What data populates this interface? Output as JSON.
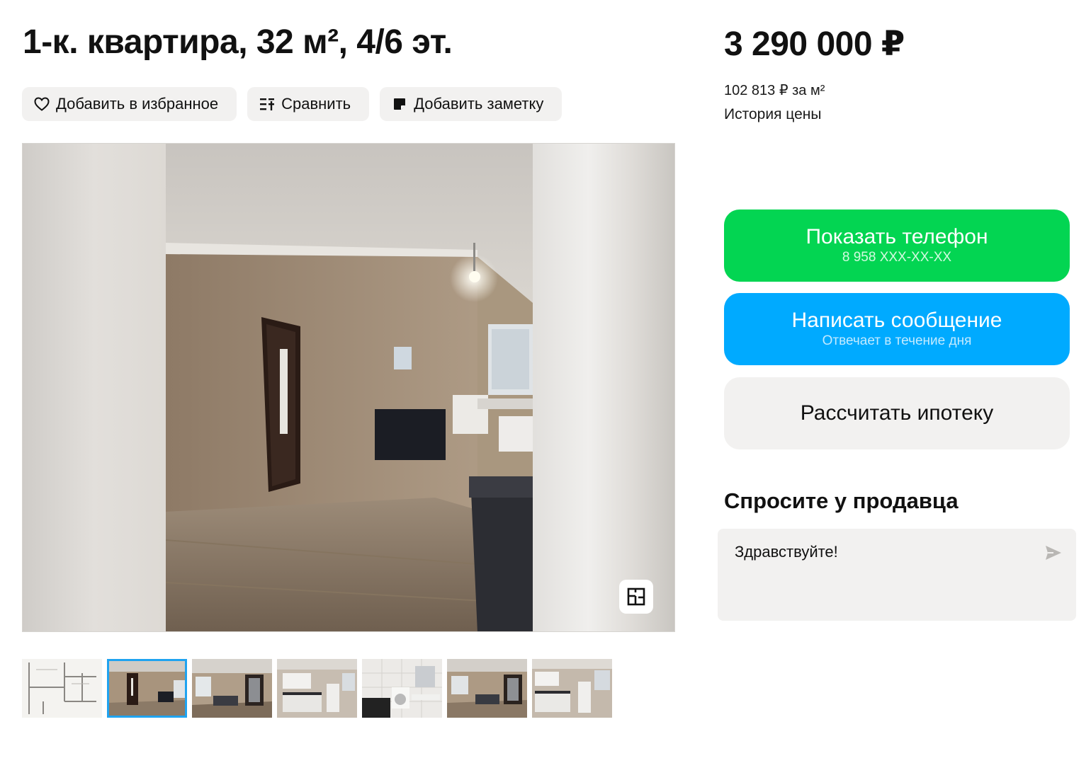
{
  "listing": {
    "title": "1-к. квартира, 32 м², 4/6 эт."
  },
  "actions": {
    "favorite": {
      "label": "Добавить в избранное",
      "icon": "heart-icon"
    },
    "compare": {
      "label": "Сравнить",
      "icon": "compare-list-icon"
    },
    "note": {
      "label": "Добавить заметку",
      "icon": "note-icon"
    }
  },
  "gallery": {
    "main_photo": "room-with-door-photo",
    "thumbnails": [
      {
        "name": "floorplan",
        "active": false
      },
      {
        "name": "room-door",
        "active": true
      },
      {
        "name": "room-sofa",
        "active": false
      },
      {
        "name": "kitchen",
        "active": false
      },
      {
        "name": "bathroom",
        "active": false
      },
      {
        "name": "room-wide",
        "active": false
      },
      {
        "name": "kitchen-2",
        "active": false
      }
    ]
  },
  "price": {
    "value": "3 290 000 ₽",
    "per_m": "102 813 ₽ за м²",
    "history": "История цены"
  },
  "cta": {
    "phone_label": "Показать телефон",
    "phone_number": "8 958 XXX-XX-XX",
    "message_label": "Написать сообщение",
    "message_sub": "Отвечает в течение дня",
    "mortgage_label": "Рассчитать ипотеку"
  },
  "ask": {
    "title": "Спросите у продавца",
    "input_value": "Здравствуйте!"
  },
  "colors": {
    "green": "#03d552",
    "blue": "#00aaff",
    "gray": "#f2f1f0",
    "thumb_active": "#1fa3f0"
  }
}
